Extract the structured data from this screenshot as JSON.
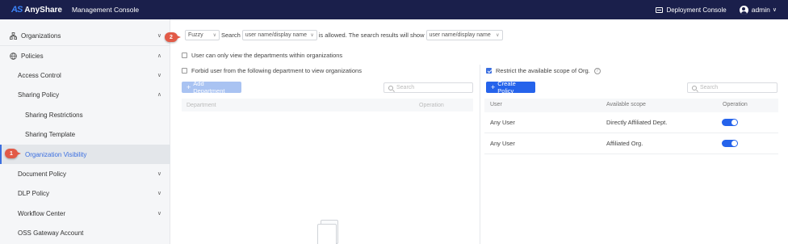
{
  "topbar": {
    "logo_mark": "AS",
    "app_name": "AnyShare",
    "console_title": "Management Console",
    "deployment_console": "Deployment Console",
    "user": "admin"
  },
  "sidebar": {
    "items": [
      {
        "label": "Organizations",
        "icon": "org-icon"
      },
      {
        "label": "Policies",
        "icon": "policy-icon"
      },
      {
        "label": "Access Control"
      },
      {
        "label": "Sharing Policy"
      },
      {
        "label": "Sharing Restrictions"
      },
      {
        "label": "Sharing Template"
      },
      {
        "label": "Organization Visibility"
      },
      {
        "label": "Document Policy"
      },
      {
        "label": "DLP Policy"
      },
      {
        "label": "Workflow Center"
      },
      {
        "label": "OSS Gateway Account"
      }
    ]
  },
  "markers": {
    "one": "1",
    "two": "2"
  },
  "search": {
    "mode": "Fuzzy",
    "search_label": "Search",
    "field1": "user name/display name",
    "allowed_text": "is allowed. The search results will show",
    "field2": "user name/display name"
  },
  "options": {
    "only_view_depts": "User can only view the departments within organizations",
    "forbid_user": "Forbid user from the following department to view organizations",
    "restrict_scope": "Restrict the available scope of Org."
  },
  "left_panel": {
    "add_department": "Add Department",
    "search_placeholder": "Search",
    "col_department": "Department",
    "col_operation": "Operation"
  },
  "right_panel": {
    "create_policy": "Create Policy",
    "search_placeholder": "Search",
    "col_user": "User",
    "col_scope": "Available scope",
    "col_operation": "Operation",
    "rows": [
      {
        "user": "Any User",
        "scope": "Directly Affiliated Dept.",
        "enabled": true
      },
      {
        "user": "Any User",
        "scope": "Affiliated Org.",
        "enabled": true
      }
    ]
  },
  "colors": {
    "accent": "#2563eb",
    "topbar": "#1a1f4b",
    "marker": "#e25a47"
  }
}
